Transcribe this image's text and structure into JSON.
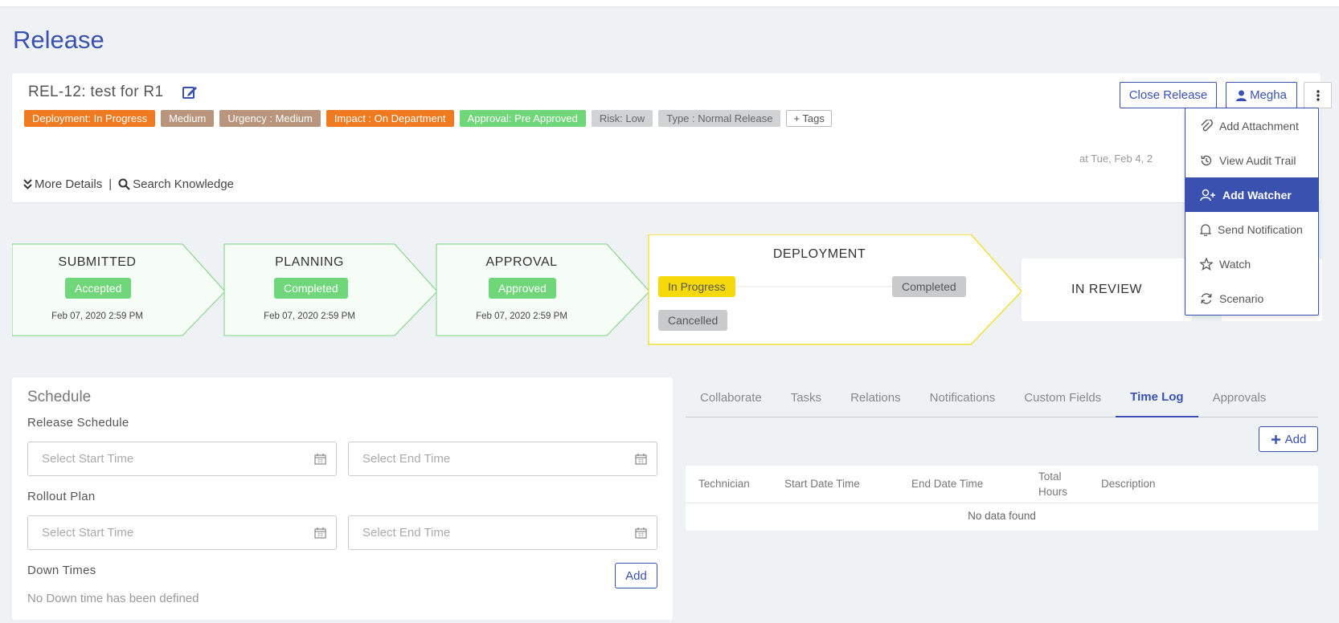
{
  "page": {
    "title": "Release"
  },
  "header": {
    "release_title": "REL-12: test for R1",
    "tags": [
      {
        "label": "Deployment: In Progress",
        "color": "#f07a20"
      },
      {
        "label": "Medium",
        "color": "#b8957c"
      },
      {
        "label": "Urgency : Medium",
        "color": "#b8957c"
      },
      {
        "label": "Impact : On Department",
        "color": "#f07a20"
      },
      {
        "label": "Approval: Pre Approved",
        "color": "#6fd67a"
      },
      {
        "label": "Risk: Low",
        "color": "#d0d2d4"
      },
      {
        "label": "Type : Normal Release",
        "color": "#d0d2d4"
      }
    ],
    "add_tags_label": "+ Tags",
    "more_details_label": "More Details",
    "separator": "|",
    "search_knowledge_label": "Search Knowledge",
    "timestamp": "at Tue, Feb 4, 2",
    "close_release_label": "Close Release",
    "assignee_label": "Megha"
  },
  "dropdown": {
    "items": [
      {
        "label": "Add Attachment",
        "icon": "paperclip-icon"
      },
      {
        "label": "View Audit Trail",
        "icon": "history-icon"
      },
      {
        "label": "Add Watcher",
        "icon": "user-plus-icon",
        "active": true
      },
      {
        "label": "Send Notification",
        "icon": "bell-icon"
      },
      {
        "label": "Watch",
        "icon": "star-icon"
      },
      {
        "label": "Scenario",
        "icon": "refresh-icon"
      }
    ]
  },
  "stages": {
    "submitted": {
      "name": "SUBMITTED",
      "status": "Accepted",
      "date": "Feb 07, 2020 2:59 PM"
    },
    "planning": {
      "name": "PLANNING",
      "status": "Completed",
      "date": "Feb 07, 2020 2:59 PM"
    },
    "approval": {
      "name": "APPROVAL",
      "status": "Approved",
      "date": "Feb 07, 2020 2:59 PM"
    },
    "deployment": {
      "name": "DEPLOYMENT",
      "in_progress": "In Progress",
      "completed": "Completed",
      "cancelled": "Cancelled"
    },
    "in_review": {
      "name": "IN REVIEW"
    },
    "colors": {
      "done_border": "#7bd17f",
      "done_fill": "#f6fdf6",
      "active_border": "#f5d90a",
      "pill_green": "#6fd67a",
      "pill_yellow": "#f5d90a",
      "pill_gray": "#c8cacc"
    }
  },
  "schedule": {
    "title": "Schedule",
    "release_schedule_label": "Release Schedule",
    "rollout_plan_label": "Rollout Plan",
    "start_placeholder": "Select Start Time",
    "end_placeholder": "Select End Time",
    "down_times_label": "Down Times",
    "add_label": "Add",
    "no_down_text": "No Down time has been defined"
  },
  "tabs": {
    "items": [
      "Collaborate",
      "Tasks",
      "Relations",
      "Notifications",
      "Custom Fields",
      "Time Log",
      "Approvals"
    ],
    "active": "Time Log"
  },
  "time_log": {
    "add_label": "Add",
    "columns": [
      "Technician",
      "Start Date Time",
      "End Date Time",
      "Total Hours",
      "Description"
    ],
    "empty_text": "No data found"
  }
}
